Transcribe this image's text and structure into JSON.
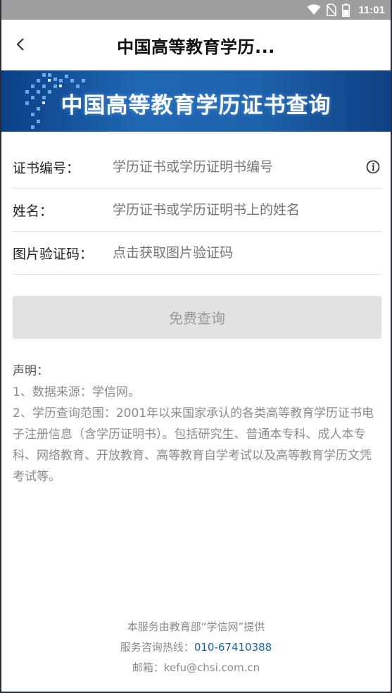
{
  "status_bar": {
    "time": "11:01",
    "icons": [
      "wifi-icon",
      "no-sim-icon",
      "battery-icon"
    ]
  },
  "app_bar": {
    "title": "中国高等教育学历...",
    "back_icon": "chevron-left-icon"
  },
  "banner": {
    "title": "中国高等教育学历证书查询"
  },
  "form": {
    "certificate": {
      "label": "证书编号：",
      "placeholder": "学历证书或学历证明书编号",
      "info_icon": "info-icon"
    },
    "name": {
      "label": "姓名：",
      "placeholder": "学历证书或学历证明书上的姓名"
    },
    "captcha": {
      "label": "图片验证码：",
      "placeholder": "点击获取图片验证码"
    }
  },
  "query_button": {
    "label": "免费查询"
  },
  "statement": {
    "heading": "声明：",
    "items": [
      "1、数据来源：学信网。",
      "2、学历查询范围：2001年以来国家承认的各类高等教育学历证书电子注册信息（含学历证明书）。包括研究生、普通本专科、成人本专科、网络教育、开放教育、高等教育自学考试以及高等教育学历文凭考试等。"
    ]
  },
  "footer": {
    "provider": "本服务由教育部“学信网”提供",
    "hotline_label": "服务咨询热线：",
    "hotline_number": "010-67410388",
    "email": "邮箱：kefu@chsi.com.cn"
  },
  "colors": {
    "banner": "#1f66b3",
    "link": "#1a5ea8",
    "button_disabled": "#e2e2e2",
    "status_bar": "#9e9e9e"
  }
}
